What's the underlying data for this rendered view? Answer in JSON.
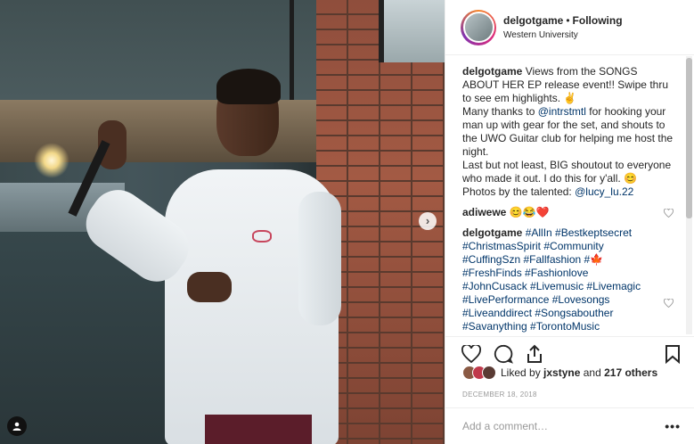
{
  "post": {
    "username": "delgotgame",
    "separator": "•",
    "follow_label": "Following",
    "location": "Western University",
    "more_icon": "ellipsis-icon",
    "next_icon": "chevron-right-icon",
    "tag_icon": "user-tag-icon"
  },
  "caption": {
    "username": "delgotgame",
    "t1": "Views from the SONGS ABOUT HER EP release event!! Swipe thru to see em highlights. ✌",
    "t2": "Many thanks to ",
    "m1": "@intrstmtl",
    "t3": " for hooking your man up with gear for the set, and shouts to the UWO Guitar club for helping me host the night.",
    "t4": "Last but not least, BIG shoutout to everyone who made it out. I do this for y'all. 😊",
    "t5": "Photos by the talented: ",
    "m2": "@lucy_lu.22"
  },
  "comments": [
    {
      "username": "adiwewe",
      "text": "😊😂❤️"
    },
    {
      "username": "delgotgame",
      "hashtags": "#AllIn #Bestkeptsecret #ChristmasSpirit #Community #CuffingSzn #Fallfashion #🍁 #FreshFinds #Fashionlove #JohnCusack #Livemusic #Livemagic #LivePerformance #Lovesongs #Liveanddirect #Songsabouther #Savanything #TorontoMusic"
    }
  ],
  "likes": {
    "prefix": "Liked by ",
    "user": "jxstyne",
    "joiner": " and ",
    "count": "217 others"
  },
  "date": "DECEMBER 18, 2018",
  "add_comment": {
    "placeholder": "Add a comment…",
    "more": "•••"
  },
  "colors": {
    "link": "#003569",
    "text": "#262626",
    "muted": "#999999",
    "border": "#efefef"
  }
}
